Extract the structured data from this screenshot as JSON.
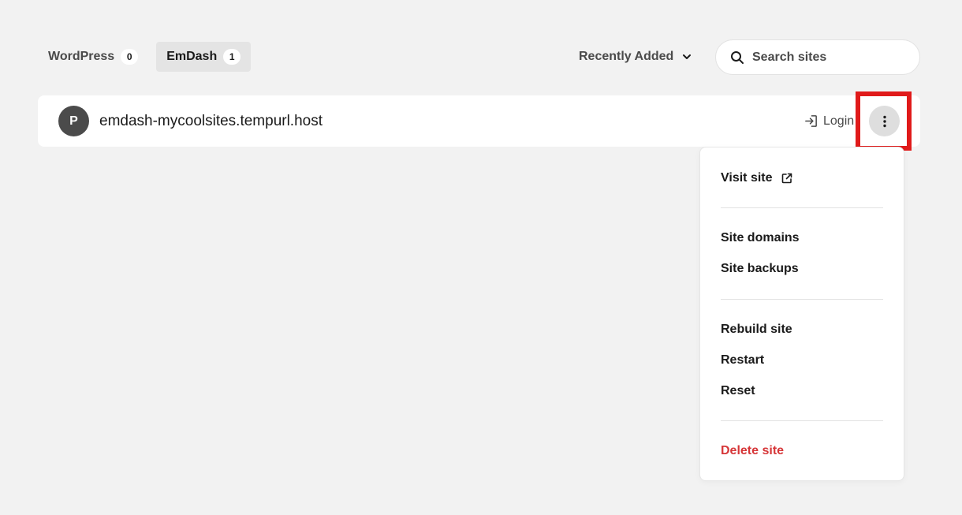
{
  "tabs": [
    {
      "label": "WordPress",
      "count": "0"
    },
    {
      "label": "EmDash",
      "count": "1"
    }
  ],
  "sort": {
    "label": "Recently Added"
  },
  "search": {
    "placeholder": "Search sites"
  },
  "site": {
    "avatar_letter": "P",
    "name": "emdash-mycoolsites.tempurl.host",
    "login_label": "Login"
  },
  "menu": {
    "visit_site": "Visit site",
    "site_domains": "Site domains",
    "site_backups": "Site backups",
    "rebuild_site": "Rebuild site",
    "restart": "Restart",
    "reset": "Reset",
    "delete_site": "Delete site"
  },
  "colors": {
    "background": "#f2f2f2",
    "highlight": "#e01a1a",
    "danger": "#d63638"
  },
  "icons": [
    "search-icon",
    "chevron-down-icon",
    "login-icon",
    "more-vertical-icon",
    "external-link-icon"
  ]
}
